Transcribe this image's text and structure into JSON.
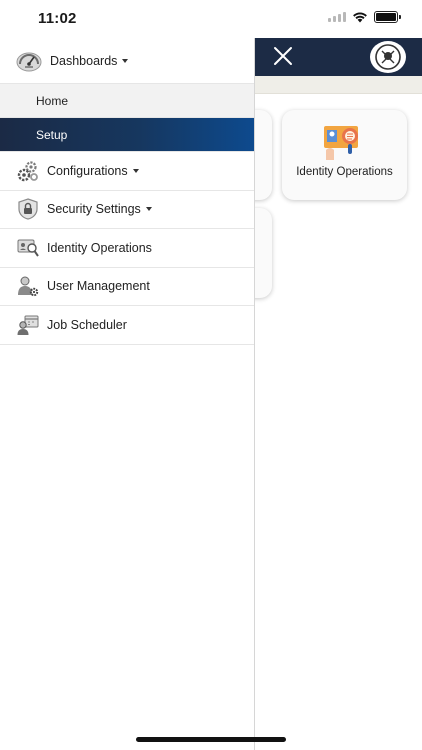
{
  "status_bar": {
    "time": "11:02"
  },
  "background": {
    "tiles": [
      {
        "label": "Identity Operations"
      }
    ]
  },
  "drawer": {
    "dashboards": {
      "label": "Dashboards"
    },
    "sub_items": [
      {
        "label": "Home",
        "selected": false
      },
      {
        "label": "Setup",
        "selected": true
      }
    ],
    "items": [
      {
        "label": "Configurations",
        "has_dropdown": true,
        "icon": "gears-icon"
      },
      {
        "label": "Security Settings",
        "has_dropdown": true,
        "icon": "shield-lock-icon"
      },
      {
        "label": "Identity Operations",
        "has_dropdown": false,
        "icon": "id-card-icon"
      },
      {
        "label": "User Management",
        "has_dropdown": false,
        "icon": "user-gear-icon"
      },
      {
        "label": "Job Scheduler",
        "has_dropdown": false,
        "icon": "calendar-user-icon"
      }
    ]
  },
  "colors": {
    "header": "#1c2b45",
    "selected_start": "#1b2a45",
    "selected_end": "#0d4a8e"
  }
}
